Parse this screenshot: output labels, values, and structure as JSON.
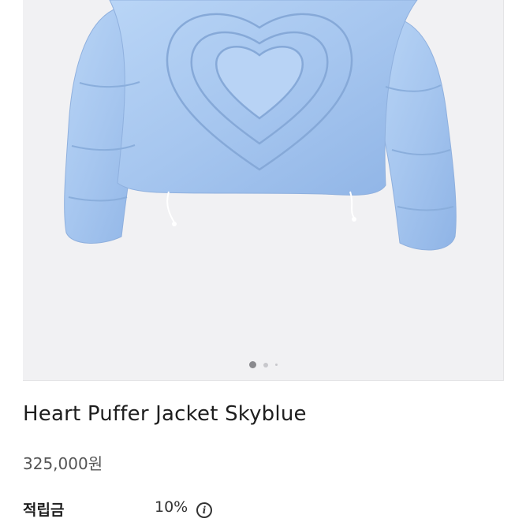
{
  "product": {
    "name": "Heart Puffer Jacket Skyblue",
    "price": "325,000원",
    "points_label": "적립금",
    "points_value": "10%",
    "info_icon": "info-icon"
  },
  "gallery": {
    "image_icon": "puffer-jacket-image",
    "slide_count": 3,
    "active_slide": 1,
    "colors": {
      "background": "#f1f1f3",
      "jacket": "#a9c8f0",
      "active_dot": "#8a8a8e",
      "inactive_dot": "#c8c8cc"
    }
  }
}
